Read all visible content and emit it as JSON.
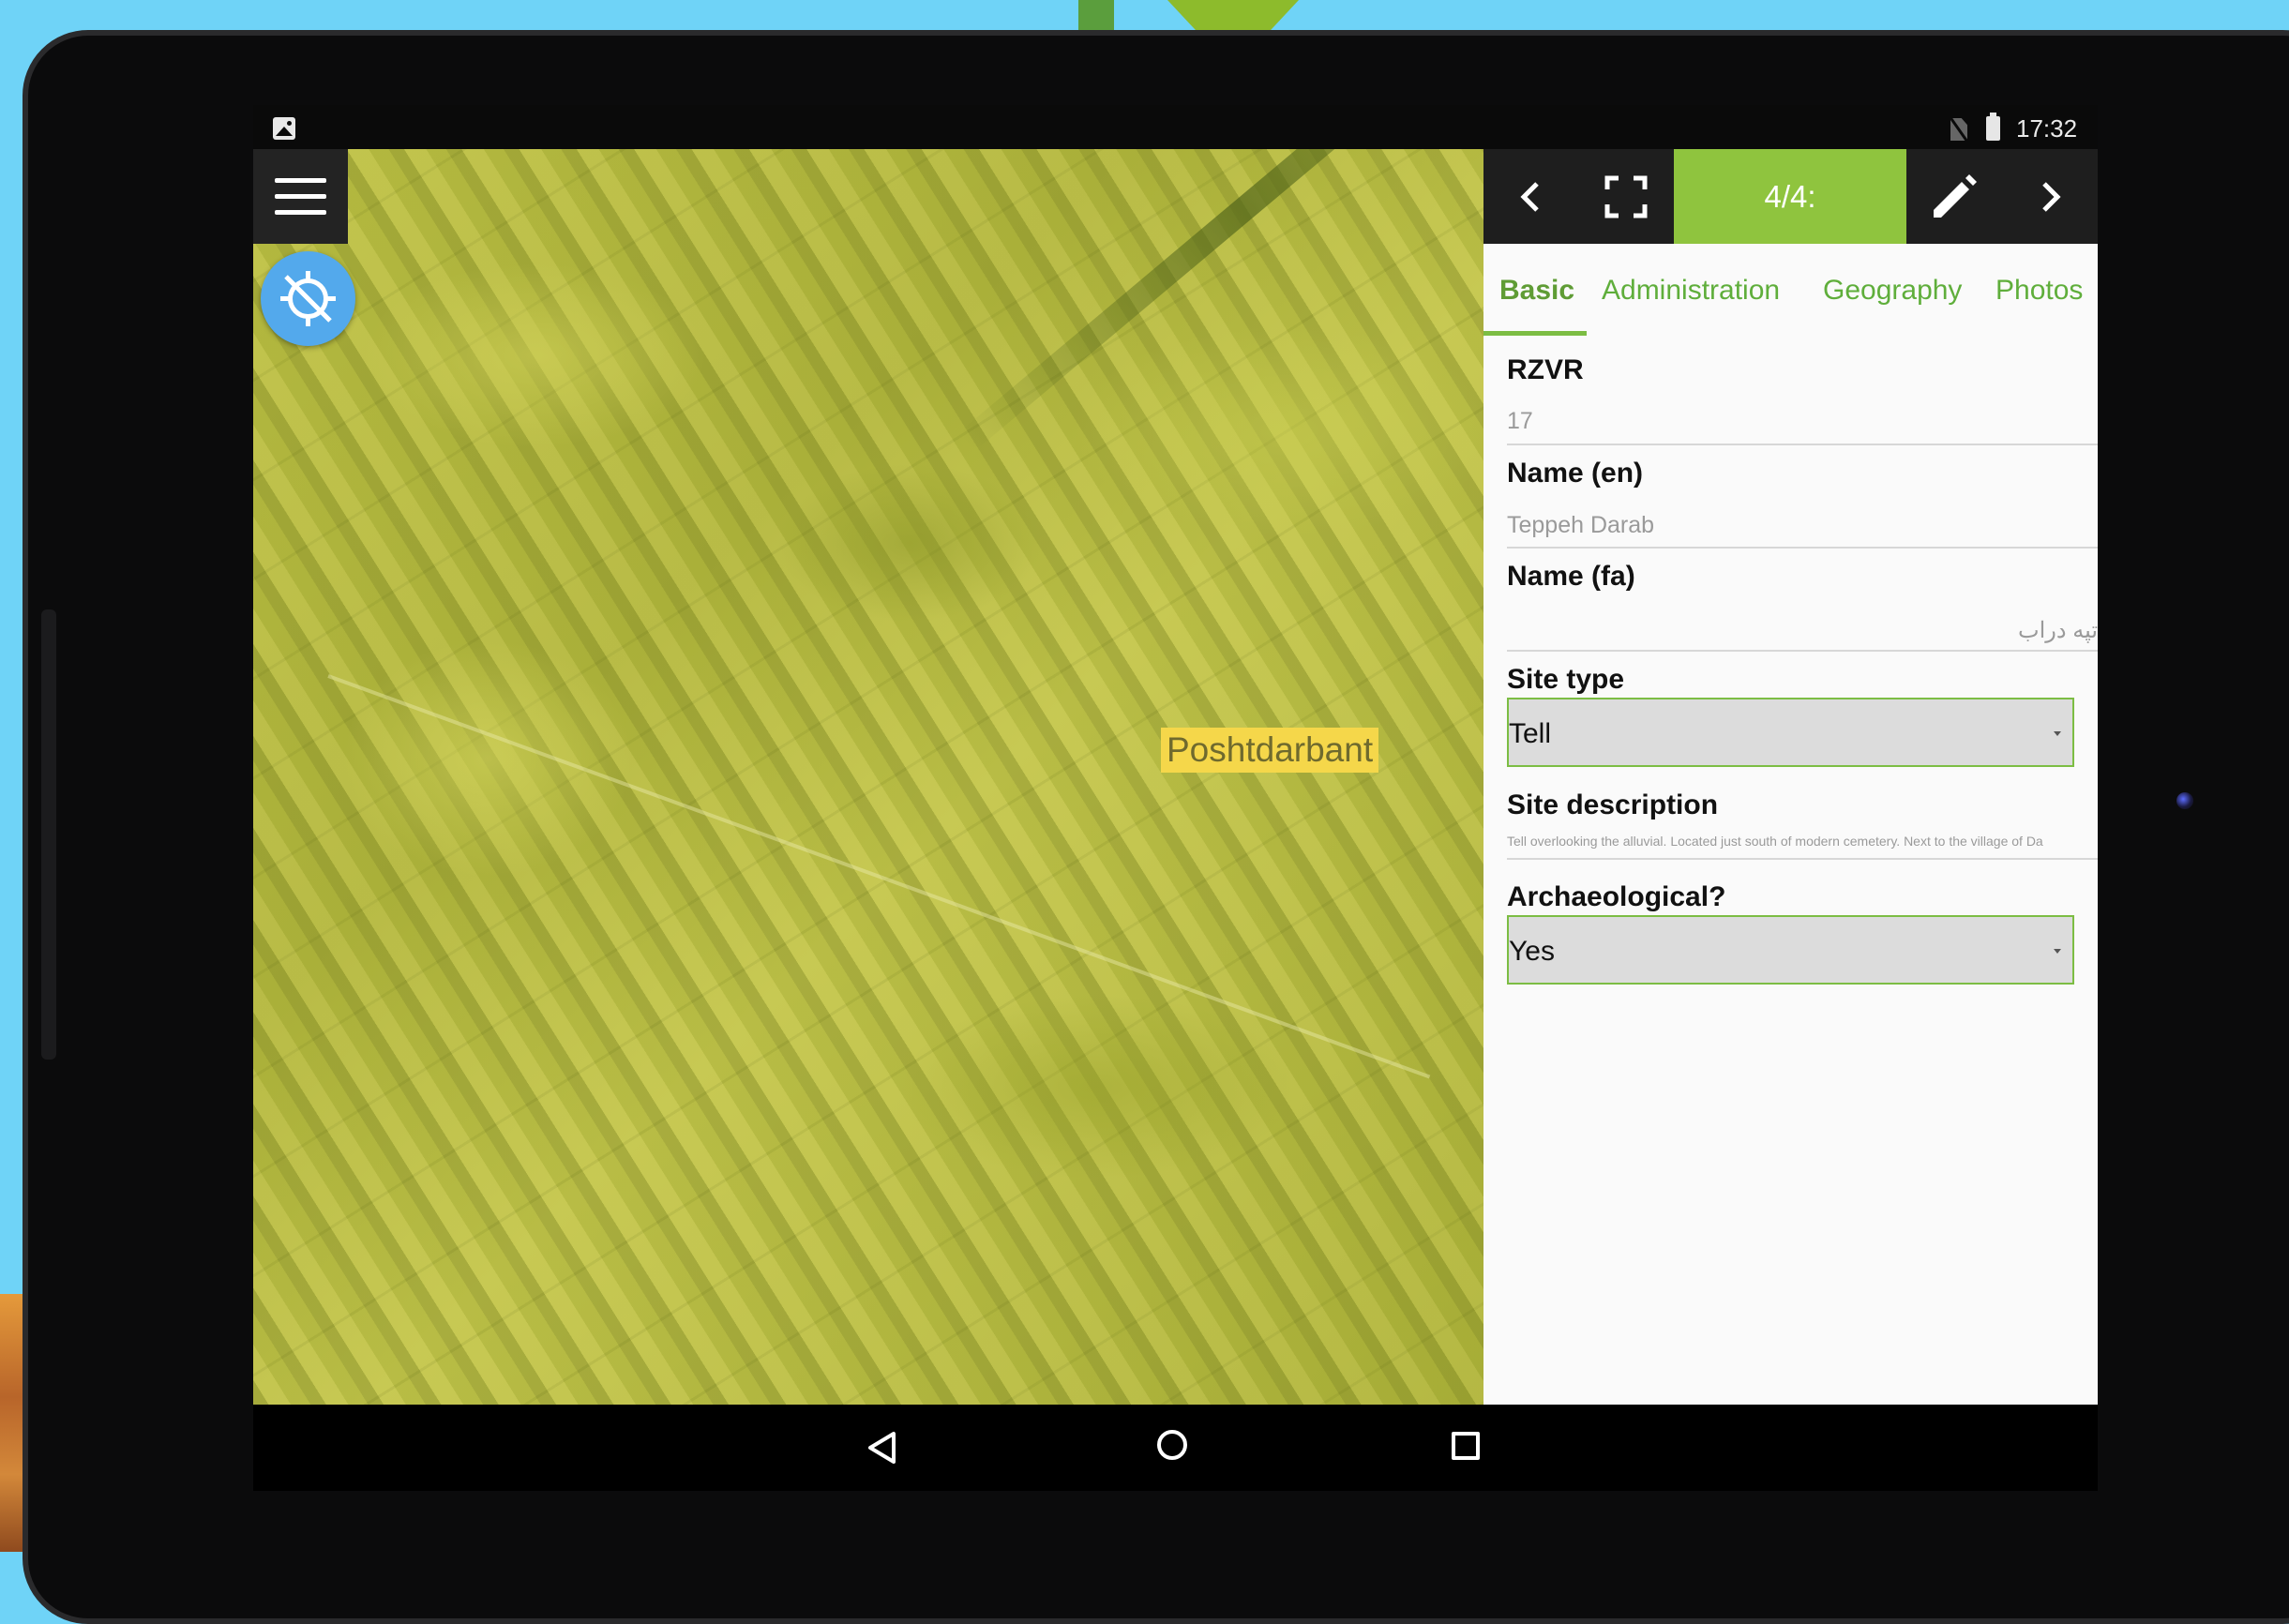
{
  "statusbar": {
    "time": "17:32"
  },
  "map": {
    "place_label": "Poshtdarbant"
  },
  "toolbar": {
    "counter": "4/4:"
  },
  "tabs": [
    {
      "label": "Basic",
      "active": true
    },
    {
      "label": "Administration",
      "active": false
    },
    {
      "label": "Geography",
      "active": false
    },
    {
      "label": "Photos",
      "active": false
    }
  ],
  "form": {
    "rzvr": {
      "label": "RZVR",
      "value": "17"
    },
    "name_en": {
      "label": "Name (en)",
      "value": "Teppeh Darab"
    },
    "name_fa": {
      "label": "Name (fa)",
      "value": "تپه دراب"
    },
    "site_type": {
      "label": "Site type",
      "value": "Tell"
    },
    "site_description": {
      "label": "Site description",
      "value": "Tell overlooking the alluvial. Located just south of modern cemetery. Next to the village of Da"
    },
    "archaeological": {
      "label": "Archaeological?",
      "value": "Yes"
    }
  },
  "colors": {
    "accent_green": "#8fc43e",
    "gps_blue": "#53a9ec",
    "label_yellow": "#f5d74a"
  }
}
